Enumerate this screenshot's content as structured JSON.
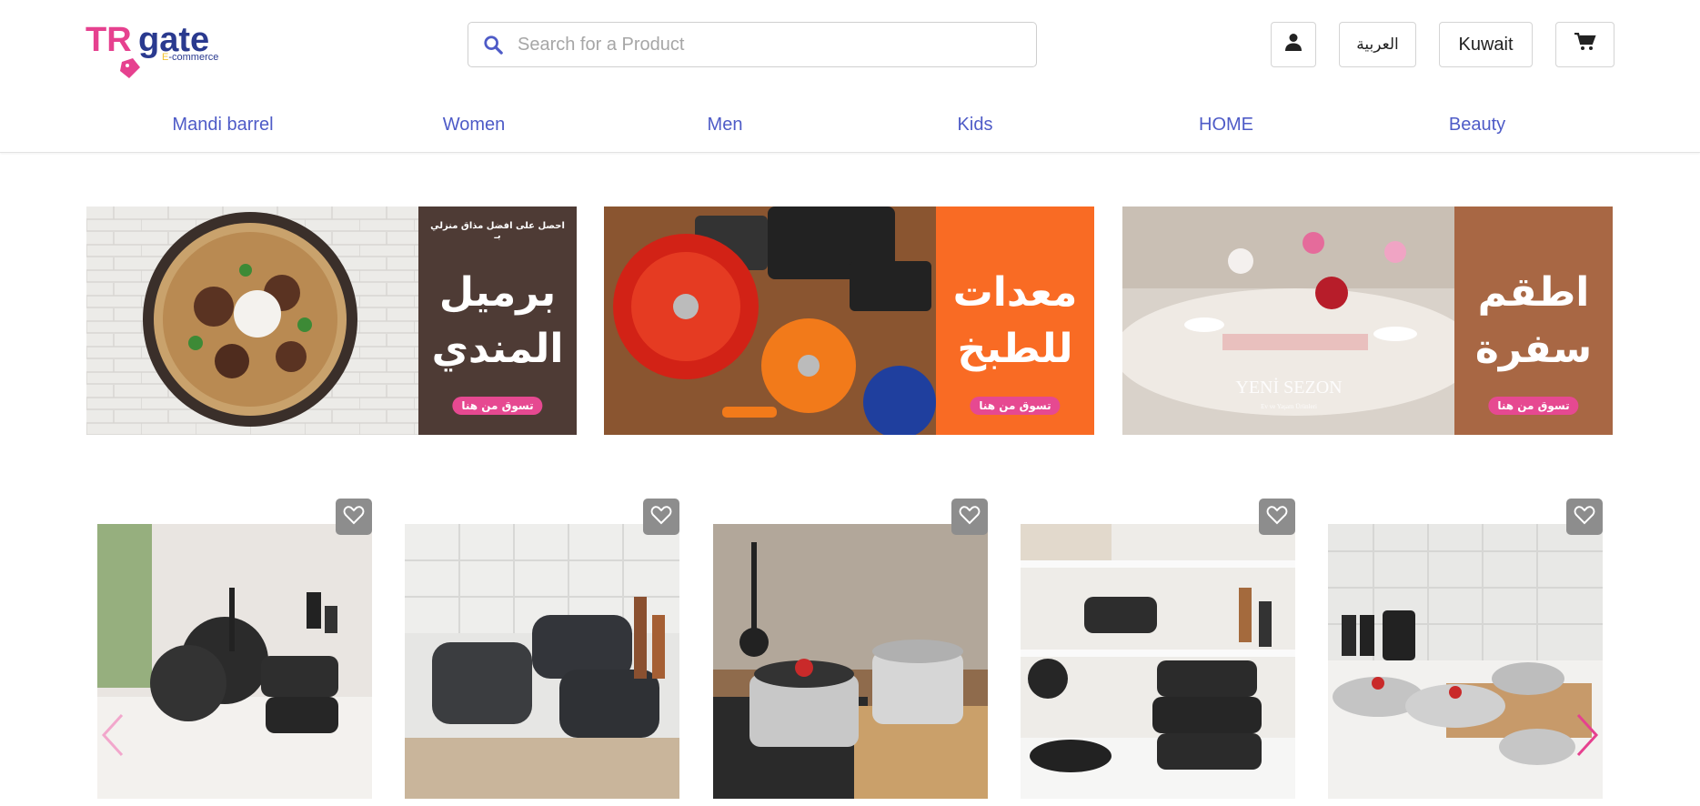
{
  "header": {
    "logo": {
      "brand": "TRGate",
      "tagline": "E-commerce"
    },
    "search": {
      "placeholder": "Search for a Product",
      "value": ""
    },
    "buttons": {
      "language": "العربية",
      "country": "Kuwait"
    }
  },
  "nav": [
    "Mandi barrel",
    "Women",
    "Men",
    "Kids",
    "HOME",
    "Beauty"
  ],
  "banners": [
    {
      "top_text": "احصل على افضل مذاق منزلي بـ",
      "title_line1": "برميل",
      "title_line2": "المندي",
      "cta": "تسوق من هنا",
      "panel_color": "#4e3b35"
    },
    {
      "top_text": "",
      "title_line1": "معدات",
      "title_line2": "للطبخ",
      "cta": "تسوق من هنا",
      "panel_color": "#f96b24"
    },
    {
      "top_text": "",
      "title_line1": "اطقم",
      "title_line2": "سفرة",
      "cta": "تسوق من هنا",
      "panel_color": "#a86744",
      "watermark": "YENİ SEZON",
      "watermark_sub": "Ev ve Yaşam Ürünleri"
    }
  ],
  "colors": {
    "accent": "#4e5bc7",
    "brand_pink": "#e6418f",
    "brand_navy": "#2a3a8f",
    "fav_bg": "#8d8d8d"
  },
  "icons": {
    "search": "search-icon",
    "user": "user-icon",
    "cart": "cart-icon",
    "heart": "heart-icon"
  }
}
